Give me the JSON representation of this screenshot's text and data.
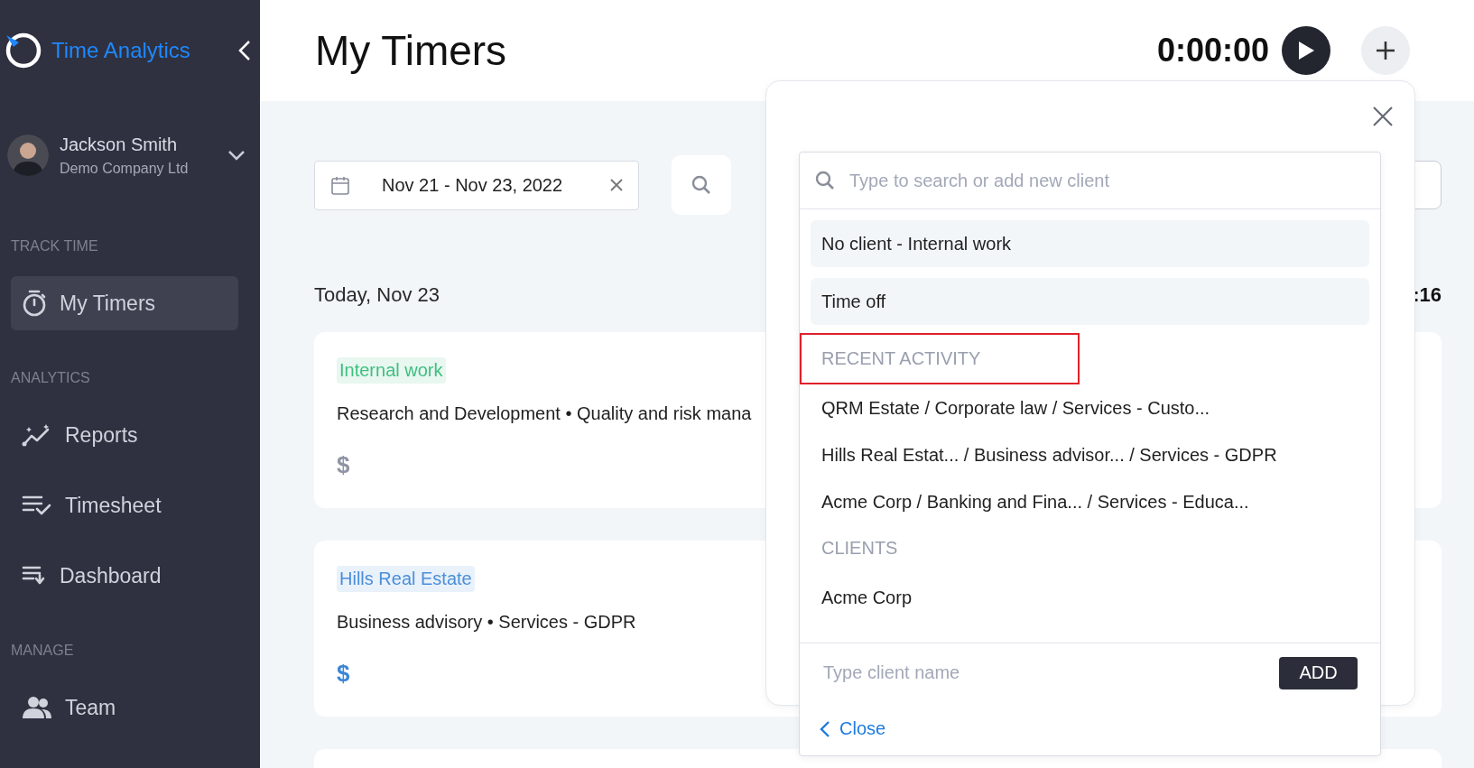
{
  "sidebar": {
    "logo": "Time Analytics",
    "user": {
      "name": "Jackson Smith",
      "company": "Demo Company Ltd"
    },
    "sections": [
      {
        "title": "TRACK TIME",
        "items": [
          {
            "label": "My Timers",
            "selected": true
          }
        ]
      },
      {
        "title": "ANALYTICS",
        "items": [
          {
            "label": "Reports",
            "selected": false
          },
          {
            "label": "Timesheet",
            "selected": false
          },
          {
            "label": "Dashboard",
            "selected": false
          }
        ]
      },
      {
        "title": "MANAGE",
        "items": [
          {
            "label": "Team",
            "selected": false
          }
        ]
      }
    ]
  },
  "header": {
    "title": "My Timers",
    "timer": "0:00:00"
  },
  "toolbar": {
    "date_range": "Nov 21 - Nov 23, 2022"
  },
  "day": {
    "label": "Today, Nov 23",
    "total": ":16"
  },
  "entries": [
    {
      "tag": "Internal work",
      "color": "#3fbf80",
      "description": "Research and Development • Quality and risk mana",
      "currency": "$",
      "billable": false
    },
    {
      "tag": "Hills Real Estate",
      "color": "#4a8fd9",
      "description": "Business advisory • Services - GDPR",
      "currency": "$",
      "billable": true
    }
  ],
  "client_picker": {
    "search": {
      "placeholder": "Type to search or add new client"
    },
    "items": [
      {
        "kind": "option",
        "label": "No client - Internal work"
      },
      {
        "kind": "option",
        "label": "Time off"
      },
      {
        "kind": "header",
        "label": "RECENT ACTIVITY",
        "highlighted": true
      },
      {
        "kind": "item",
        "label": "QRM Estate / Corporate law / Services - Custo..."
      },
      {
        "kind": "item",
        "label": "Hills Real Estat... / Business advisor... / Services - GDPR"
      },
      {
        "kind": "item",
        "label": "Acme Corp / Banking and Fina... / Services - Educa..."
      },
      {
        "kind": "header",
        "label": "CLIENTS",
        "highlighted": false
      },
      {
        "kind": "item",
        "label": "Acme Corp"
      }
    ],
    "new_client": {
      "placeholder": "Type client name",
      "button": "ADD"
    },
    "close": "Close"
  }
}
